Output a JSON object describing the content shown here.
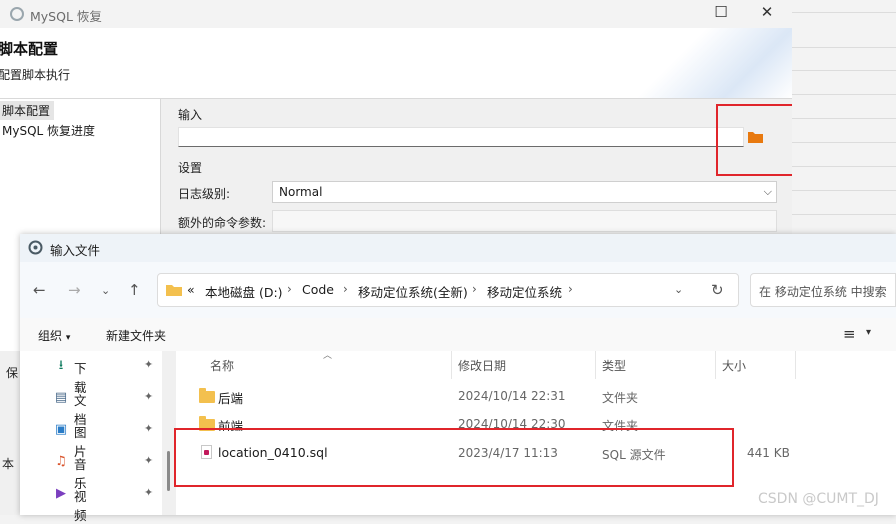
{
  "background_window": {
    "title": "MySQL 恢复",
    "controls": {
      "maximize": "☐",
      "close": "✕"
    },
    "header": {
      "title": "脚本配置",
      "subtitle": "配置脚本执行"
    },
    "nav_items": [
      {
        "label": "脚本配置",
        "selected": true
      },
      {
        "label": "MySQL 恢复进度",
        "selected": false
      }
    ],
    "input_group": {
      "label": "输入",
      "value": ""
    },
    "settings_group": {
      "label": "设置",
      "log_level_label": "日志级别:",
      "log_level_value": "Normal",
      "extra_args_label": "额外的命令参数:",
      "extra_args_value": ""
    },
    "left_fragments": [
      "保",
      "本"
    ]
  },
  "dialog": {
    "title": "输入文件",
    "breadcrumb": [
      "«",
      "本地磁盘 (D:)",
      "Code",
      "移动定位系统(全新)",
      "移动定位系统"
    ],
    "search_placeholder": "在 移动定位系统 中搜索",
    "command_bar": {
      "organize": "组织",
      "new_folder": "新建文件夹"
    },
    "nav_items": [
      {
        "label": "下载",
        "icon": "download-icon"
      },
      {
        "label": "文档",
        "icon": "document-icon"
      },
      {
        "label": "图片",
        "icon": "picture-icon"
      },
      {
        "label": "音乐",
        "icon": "music-icon"
      },
      {
        "label": "视频",
        "icon": "video-icon"
      }
    ],
    "columns": {
      "name": "名称",
      "modified": "修改日期",
      "type": "类型",
      "size": "大小"
    },
    "files": [
      {
        "name": "后端",
        "modified": "2024/10/14 22:31",
        "type": "文件夹",
        "size": "",
        "kind": "folder"
      },
      {
        "name": "前端",
        "modified": "2024/10/14 22:30",
        "type": "文件夹",
        "size": "",
        "kind": "folder"
      },
      {
        "name": "location_0410.sql",
        "modified": "2023/4/17 11:13",
        "type": "SQL 源文件",
        "size": "441 KB",
        "kind": "sql"
      }
    ]
  },
  "watermark": "CSDN @CUMT_DJ",
  "colors": {
    "highlight_red": "#e0252b",
    "folder": "#f3c04e",
    "accent_orange": "#e8790f"
  }
}
